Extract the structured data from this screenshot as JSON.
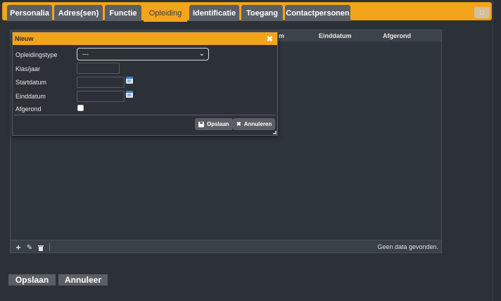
{
  "tabs": [
    {
      "label": "Personalia"
    },
    {
      "label": "Adres(sen)"
    },
    {
      "label": "Functie"
    },
    {
      "label": "Opleiding"
    },
    {
      "label": "Identificatie"
    },
    {
      "label": "Toegang"
    },
    {
      "label": "Contactpersonen"
    }
  ],
  "active_tab": "Opleiding",
  "grid": {
    "columns": [
      "m",
      "Einddatum",
      "Afgerond"
    ],
    "empty_message": "Geen data gevonden.",
    "toolbar_icons": [
      "add-icon",
      "edit-icon",
      "delete-icon"
    ]
  },
  "dialog": {
    "title": "Nieuw",
    "fields": {
      "opleidingstype": {
        "label": "Opleidingstype",
        "value": "---"
      },
      "klas_jaar": {
        "label": "Klas/jaar",
        "value": ""
      },
      "startdatum": {
        "label": "Startdatum",
        "value": ""
      },
      "einddatum": {
        "label": "Einddatum",
        "value": ""
      },
      "afgerond": {
        "label": "Afgerond",
        "checked": false
      }
    },
    "save_label": "Opslaan",
    "cancel_label": "Annuleren"
  },
  "footer": {
    "save_label": "Opslaan",
    "cancel_label": "Annuleer"
  },
  "colors": {
    "accent": "#f2a51a",
    "background": "#2c3138",
    "button": "#5a5f66"
  }
}
